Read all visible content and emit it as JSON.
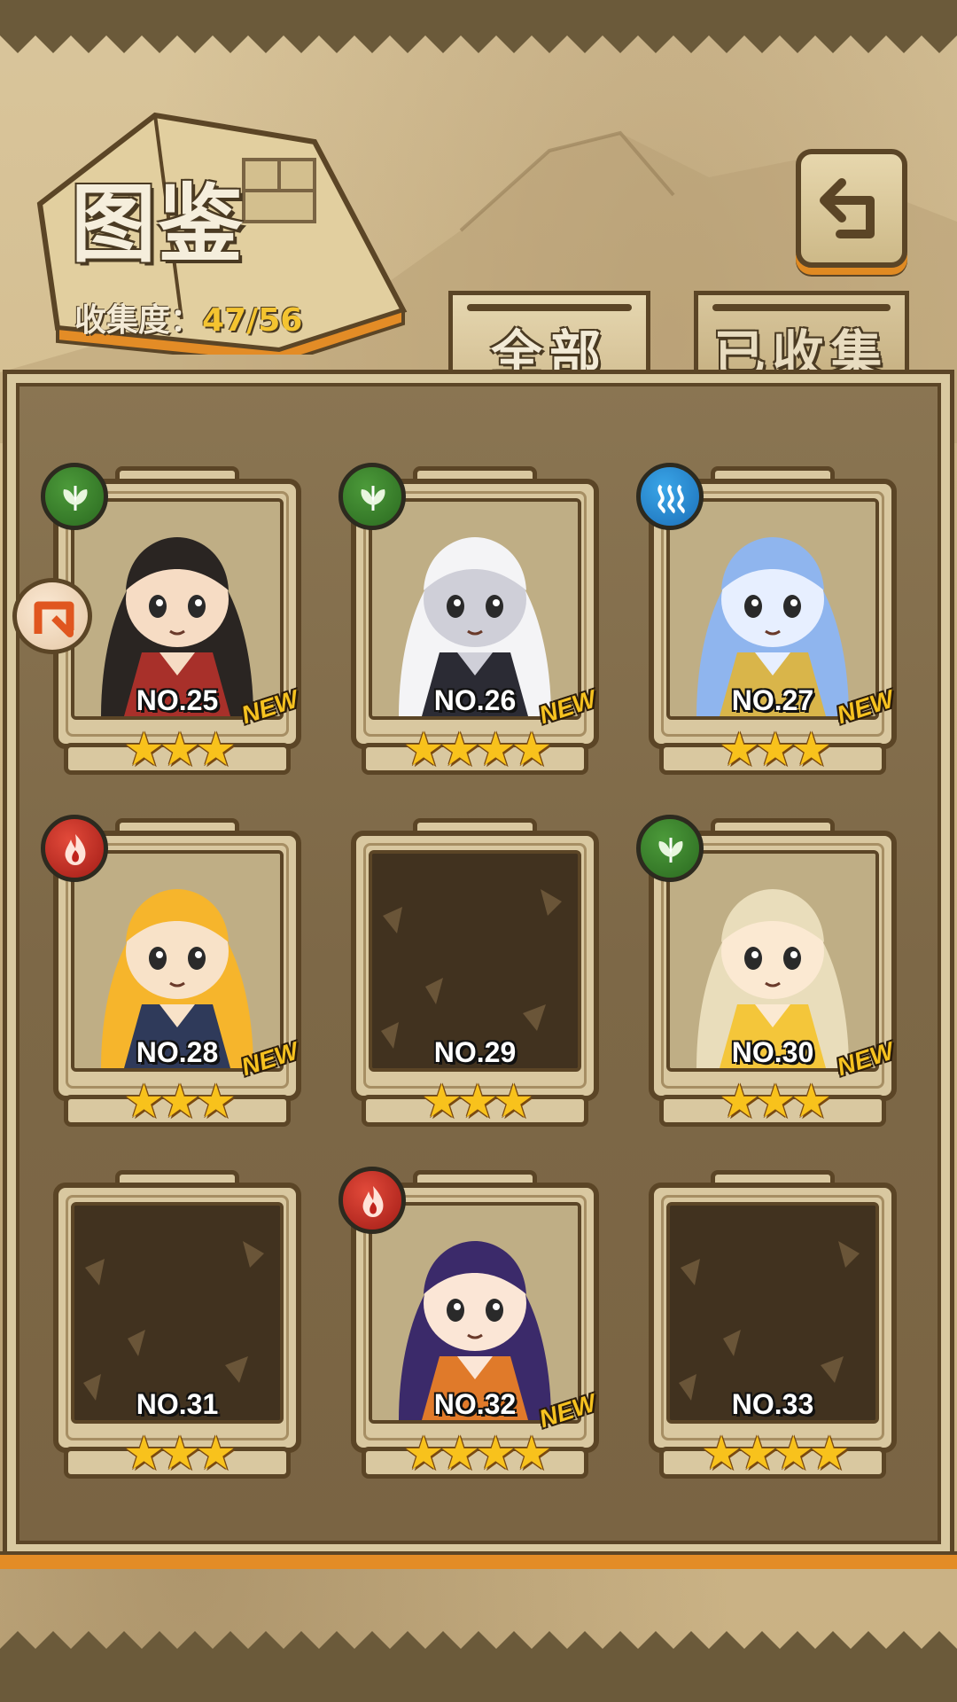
{
  "header": {
    "title": "图鉴",
    "collect_label": "收集度：",
    "collect_value": "47/56"
  },
  "tabs": [
    {
      "label": "全部",
      "active": true
    },
    {
      "label": "已收集",
      "active": false
    }
  ],
  "icons": {
    "back": "back-return-icon",
    "side": "side-arrow-icon",
    "star": "★"
  },
  "cards": [
    {
      "no": "NO.25",
      "new": "NEW",
      "stars": "★★★",
      "element": "leaf",
      "locked": false,
      "hair": "#2a2522",
      "skin": "#f6dcc4",
      "accent": "#a8302a"
    },
    {
      "no": "NO.26",
      "new": "NEW",
      "stars": "★★★★",
      "element": "leaf",
      "locked": false,
      "hair": "#f4f4f6",
      "skin": "#cfcfd8",
      "accent": "#2b2b34"
    },
    {
      "no": "NO.27",
      "new": "NEW",
      "stars": "★★★",
      "element": "water",
      "locked": false,
      "hair": "#8fb5ee",
      "skin": "#e7efff",
      "accent": "#d9b54a"
    },
    {
      "no": "NO.28",
      "new": "NEW",
      "stars": "★★★",
      "element": "fire",
      "locked": false,
      "hair": "#f6b52c",
      "skin": "#f8e2c8",
      "accent": "#2f3a5a"
    },
    {
      "no": "NO.29",
      "new": "",
      "stars": "★★★",
      "element": "",
      "locked": true
    },
    {
      "no": "NO.30",
      "new": "NEW",
      "stars": "★★★",
      "element": "leaf",
      "locked": false,
      "hair": "#e9ddbb",
      "skin": "#fbe9d2",
      "accent": "#f4c63a"
    },
    {
      "no": "NO.31",
      "new": "",
      "stars": "★★★",
      "element": "",
      "locked": true
    },
    {
      "no": "NO.32",
      "new": "NEW",
      "stars": "★★★★",
      "element": "fire",
      "locked": false,
      "hair": "#3b2a6a",
      "skin": "#fbe6d6",
      "accent": "#e07a2a"
    },
    {
      "no": "NO.33",
      "new": "",
      "stars": "★★★★",
      "element": "",
      "locked": true
    }
  ],
  "colors": {
    "frame_dark": "#5b4526",
    "frame_light": "#d9c8a0",
    "panel": "#7d6847",
    "accent_orange": "#e38c26",
    "star_gold": "#f8c21c",
    "collect_gold": "#f4c430"
  }
}
